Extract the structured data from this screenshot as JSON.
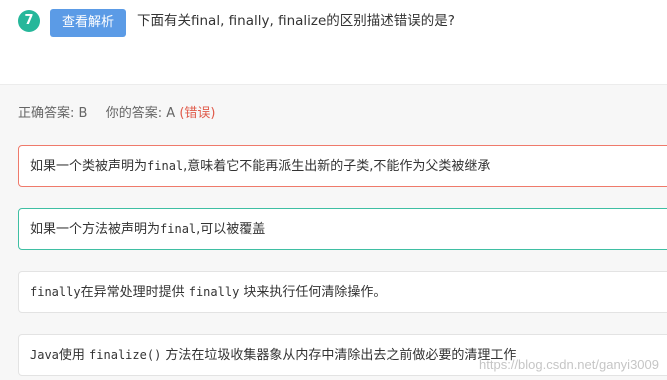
{
  "question": {
    "number": "7",
    "view_analysis_label": "查看解析",
    "text": "下面有关final, finally, finalize的区别描述错误的是?"
  },
  "answer": {
    "correct_label": "正确答案:",
    "correct_value": "B",
    "yours_label": "你的答案:",
    "yours_value": "A",
    "status": "(错误)"
  },
  "options": [
    {
      "segments": [
        "如果一个类被声明为",
        "final",
        ",意味着它不能再派生出新的子类,不能作为父类被继承"
      ]
    },
    {
      "segments": [
        "如果一个方法被声明为",
        "final",
        ",可以被覆盖"
      ]
    },
    {
      "segments": [
        "finally",
        "在异常处理时提供 ",
        "finally",
        " 块来执行任何清除操作。"
      ]
    },
    {
      "segments": [
        "Java",
        "使用 ",
        "finalize()",
        " 方法在垃圾收集器象从内存中清除出去之前做必要的清理工作"
      ]
    }
  ],
  "watermark": "https://blog.csdn.net/ganyi3009",
  "colors": {
    "number_badge": "#26b79a",
    "button": "#5b9be6",
    "wrong_text": "#e05b4b",
    "selected_wrong_border": "#ef7a6b",
    "correct_border": "#3fbfa3"
  }
}
